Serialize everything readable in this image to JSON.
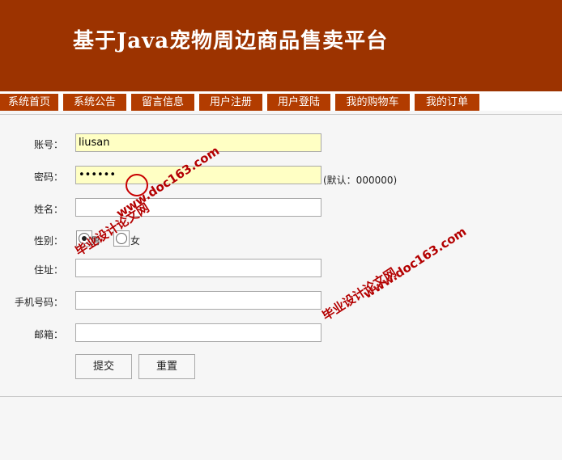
{
  "header": {
    "title": "基于Java宠物周边商品售卖平台"
  },
  "nav": [
    {
      "label": "系统首页"
    },
    {
      "label": "系统公告"
    },
    {
      "label": "留言信息"
    },
    {
      "label": "用户注册"
    },
    {
      "label": "用户登陆"
    },
    {
      "label": "我的购物车"
    },
    {
      "label": "我的订单"
    }
  ],
  "form": {
    "account": {
      "label": "账号：",
      "value": "liusan"
    },
    "password": {
      "label": "密码：",
      "value": "liusan",
      "hint": "(默认：000000)"
    },
    "name": {
      "label": "姓名：",
      "value": ""
    },
    "gender": {
      "label": "性别：",
      "option_male": "男",
      "option_female": "女",
      "selected": "男"
    },
    "address": {
      "label": "住址：",
      "value": ""
    },
    "phone": {
      "label": "手机号码：",
      "value": ""
    },
    "email": {
      "label": "邮箱：",
      "value": ""
    },
    "submit_label": "提交",
    "reset_label": "重置"
  },
  "watermarks": [
    {
      "line1": "www.doc163.com",
      "line2": "毕业设计论文网"
    },
    {
      "line1": "www.doc163.com",
      "line2": "毕业设计论文网"
    }
  ],
  "colors": {
    "header_bg": "#9c3300",
    "nav_bg": "#b23c00",
    "watermark": "#b30000"
  }
}
